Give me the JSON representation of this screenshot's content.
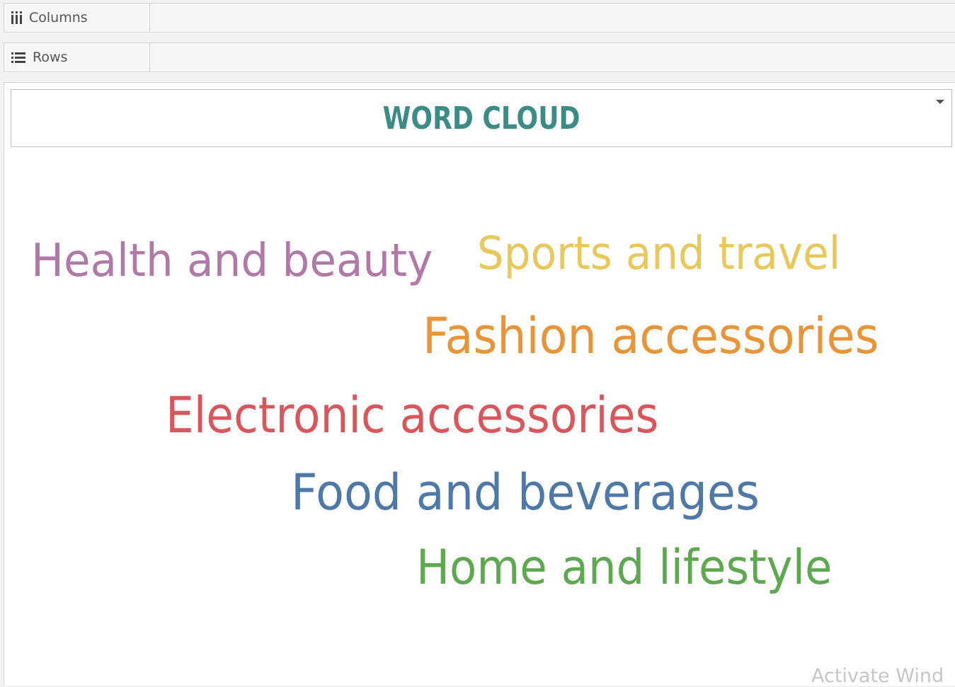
{
  "shelves": {
    "columns": {
      "label": "Columns",
      "icon": "columns-icon"
    },
    "rows": {
      "label": "Rows",
      "icon": "rows-icon"
    }
  },
  "worksheet": {
    "title": "WORD CLOUD",
    "title_color": "#3a8c85"
  },
  "word_cloud": {
    "words": [
      {
        "text": "Health and beauty",
        "color": "#b07aa8"
      },
      {
        "text": "Sports and travel",
        "color": "#e8c85a"
      },
      {
        "text": "Fashion accessories",
        "color": "#e8953a"
      },
      {
        "text": "Electronic accessories",
        "color": "#d9575c"
      },
      {
        "text": "Food and beverages",
        "color": "#4e79a7"
      },
      {
        "text": "Home and lifestyle",
        "color": "#5ea84f"
      }
    ]
  },
  "watermark": "Activate Wind"
}
